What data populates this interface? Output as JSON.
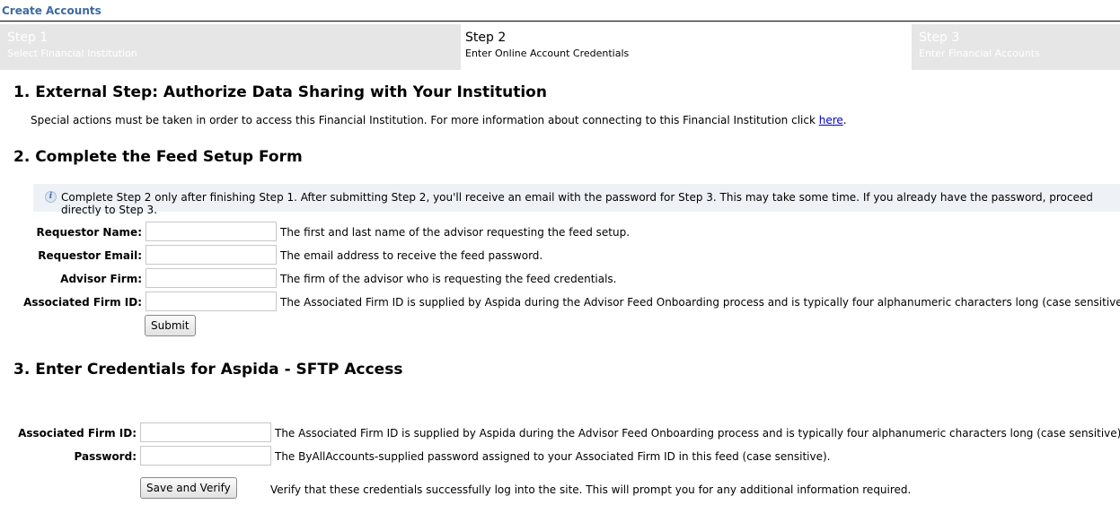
{
  "header": {
    "title": "Create Accounts"
  },
  "steps": [
    {
      "num": "Step 1",
      "sub": "Select Financial Institution"
    },
    {
      "num": "Step 2",
      "sub": "Enter Online Account Credentials"
    },
    {
      "num": "Step 3",
      "sub": "Enter Financial Accounts"
    }
  ],
  "section1": {
    "heading": "1. External Step: Authorize Data Sharing with Your Institution",
    "text": "Special actions must be taken in order to access this Financial Institution. For more information about connecting to this Financial Institution click ",
    "link": "here",
    "period": "."
  },
  "section2": {
    "heading": "2. Complete the Feed Setup Form",
    "info_icon": "info-icon",
    "info": "Complete Step 2 only after finishing Step 1. After submitting Step 2, you'll receive an email with the password for Step 3. This may take some time. If you already have the password, proceed directly to Step 3.",
    "fields": [
      {
        "label": "Requestor Name:",
        "value": "",
        "hint": "The first and last name of the advisor requesting the feed setup."
      },
      {
        "label": "Requestor Email:",
        "value": "",
        "hint": "The email address to receive the feed password."
      },
      {
        "label": "Advisor Firm:",
        "value": "",
        "hint": "The firm of the advisor who is requesting the feed credentials."
      },
      {
        "label": "Associated Firm ID:",
        "value": "",
        "hint": "The Associated Firm ID is supplied by Aspida during the Advisor Feed Onboarding process and is typically four alphanumeric characters long (case sensitive)."
      }
    ],
    "submit_label": "Submit"
  },
  "section3": {
    "heading": "3. Enter Credentials for Aspida - SFTP Access",
    "fields": [
      {
        "label": "Associated Firm ID:",
        "value": "",
        "hint": "The Associated Firm ID is supplied by Aspida during the Advisor Feed Onboarding process and is typically four alphanumeric characters long (case sensitive)."
      },
      {
        "label": "Password:",
        "value": "",
        "hint": "The ByAllAccounts-supplied password assigned to your Associated Firm ID in this feed (case sensitive)."
      }
    ],
    "save_label": "Save and Verify",
    "save_hint": "Verify that these credentials successfully log into the site. This will prompt you for any additional information required."
  }
}
